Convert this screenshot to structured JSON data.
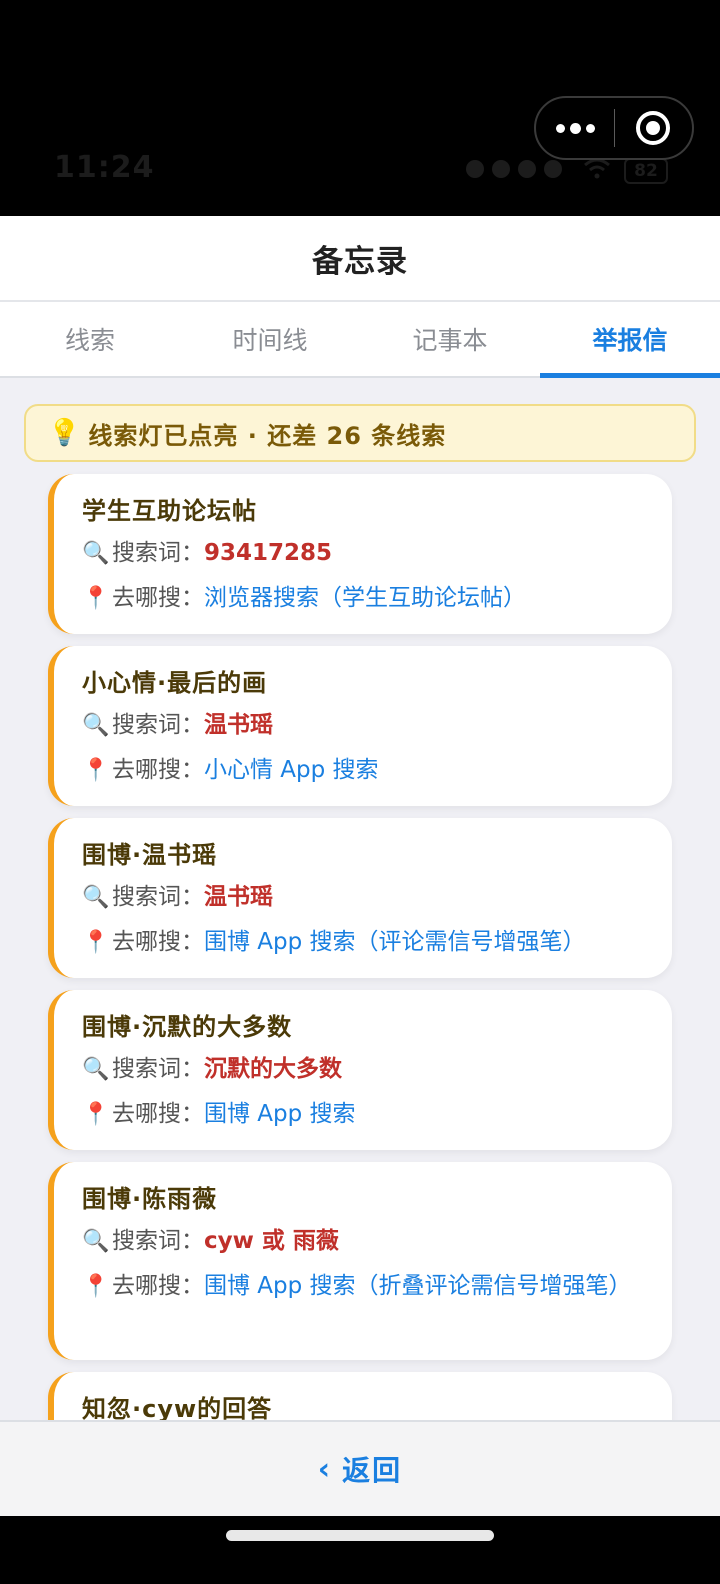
{
  "status_bar": {
    "time": "11:24",
    "battery": "82"
  },
  "icons": {
    "more": "more-dots-icon",
    "close": "mini-program-close-icon",
    "bulb": "💡",
    "search": "🔍",
    "pin": "📍",
    "back": "chevron-left-icon"
  },
  "header": {
    "title": "备忘录"
  },
  "tabs": [
    {
      "label": "线索",
      "active": false
    },
    {
      "label": "时间线",
      "active": false
    },
    {
      "label": "记事本",
      "active": false
    },
    {
      "label": "举报信",
      "active": true
    }
  ],
  "hint": {
    "text": "线索灯已点亮 · 还差 26 条线索"
  },
  "labels": {
    "keyword": "搜索词：",
    "where": "去哪搜："
  },
  "cards": [
    {
      "title": "学生互助论坛帖",
      "keyword": "93417285",
      "where": "浏览器搜索（学生互助论坛帖）"
    },
    {
      "title": "小心情·最后的画",
      "keyword": "温书瑶",
      "where": "小心情 App 搜索"
    },
    {
      "title": "围博·温书瑶",
      "keyword": "温书瑶",
      "where": "围博 App 搜索（评论需信号增强笔）"
    },
    {
      "title": "围博·沉默的大多数",
      "keyword": "沉默的大多数",
      "where": "围博 App 搜索"
    },
    {
      "title": "围博·陈雨薇",
      "keyword": "cyw 或 雨薇",
      "where": "围博 App 搜索（折叠评论需信号增强笔）"
    },
    {
      "title": "知忽·cyw的回答"
    }
  ],
  "footer": {
    "back_label": "返回"
  },
  "colors": {
    "accent": "#1a7fe0",
    "card_border": "#f5a11c",
    "keyword": "#c0302a",
    "hint_bg": "#fdf5d6"
  }
}
